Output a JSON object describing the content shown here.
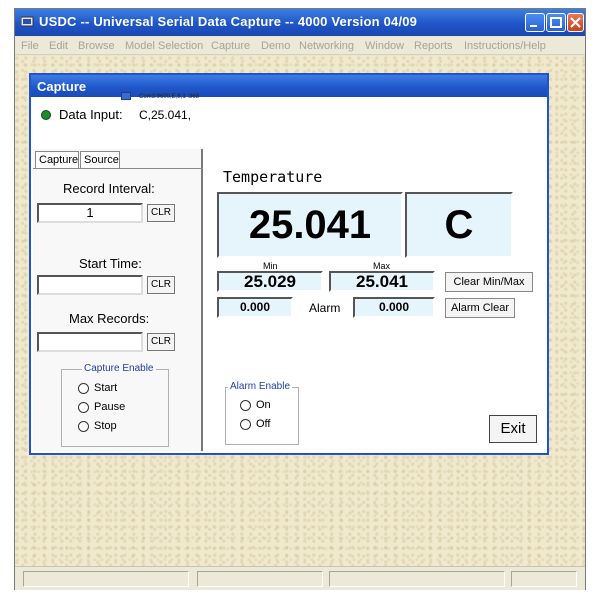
{
  "window": {
    "title": "USDC -- Universal Serial Data Capture -- 4000   Version 04/09",
    "controls": [
      "minimize-icon",
      "maximize-icon",
      "close-icon"
    ]
  },
  "menu": [
    "File",
    "Edit",
    "Browse",
    "Model Selection",
    "Capture",
    "Demo",
    "Networking",
    "Window",
    "Reports",
    "Instructions/Help"
  ],
  "capture": {
    "title": "Capture",
    "com_settings": "Com3:9600,E,8,1 :368",
    "data_input_label": "Data Input:",
    "data_input_value": "C,25.041,",
    "tabs": [
      "Capture",
      "Source"
    ],
    "record_interval_label": "Record Interval:",
    "record_interval_value": "1",
    "start_time_label": "Start Time:",
    "start_time_value": "",
    "max_records_label": "Max Records:",
    "max_records_value": "",
    "clr_label": "CLR",
    "capture_enable": {
      "title": "Capture Enable",
      "options": [
        "Start",
        "Pause",
        "Stop"
      ]
    },
    "measurement_title": "Temperature",
    "reading": "25.041",
    "unit": "C",
    "min_label": "Min",
    "max_label": "Max",
    "min_value": "25.029",
    "max_value": "25.041",
    "clear_minmax_label": "Clear Min/Max",
    "alarm_low": "0.000",
    "alarm_label": "Alarm",
    "alarm_high": "0.000",
    "alarm_clear_label": "Alarm Clear",
    "alarm_enable": {
      "title": "Alarm Enable",
      "options": [
        "On",
        "Off"
      ]
    },
    "exit_label": "Exit"
  },
  "colors": {
    "titlebar": "#1f55c8",
    "led": "#1e8a2a",
    "value_bg": "#e6f4fb",
    "client_bg": "#f0e9cd"
  }
}
